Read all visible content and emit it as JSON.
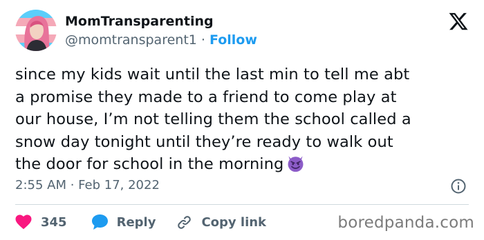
{
  "author": {
    "display_name": "MomTransparenting",
    "handle": "@momtransparent1",
    "separator": "·",
    "follow_label": "Follow"
  },
  "tweet": {
    "text": "since my kids wait until the last min to tell me abt\na promise they made to a friend to come play at\nour house, I’m not telling them the school called a\nsnow day tonight until they’re ready to walk out\nthe door for school in the morning",
    "emoji": "smiling-face-with-horns",
    "timestamp": "2:55 AM · Feb 17, 2022"
  },
  "actions": {
    "like_count": "345",
    "reply_label": "Reply",
    "copy_link_label": "Copy link"
  },
  "watermark": "boredpanda.com",
  "colors": {
    "like": "#f91880",
    "reply": "#1d9bf0",
    "follow": "#1d9bf0",
    "secondary_text": "#536471",
    "emoji": "#8c5cc8"
  },
  "icons": [
    "avatar",
    "x-logo-icon",
    "info-icon",
    "heart-icon",
    "reply-bubble-icon",
    "link-icon",
    "devil-emoji-icon"
  ]
}
